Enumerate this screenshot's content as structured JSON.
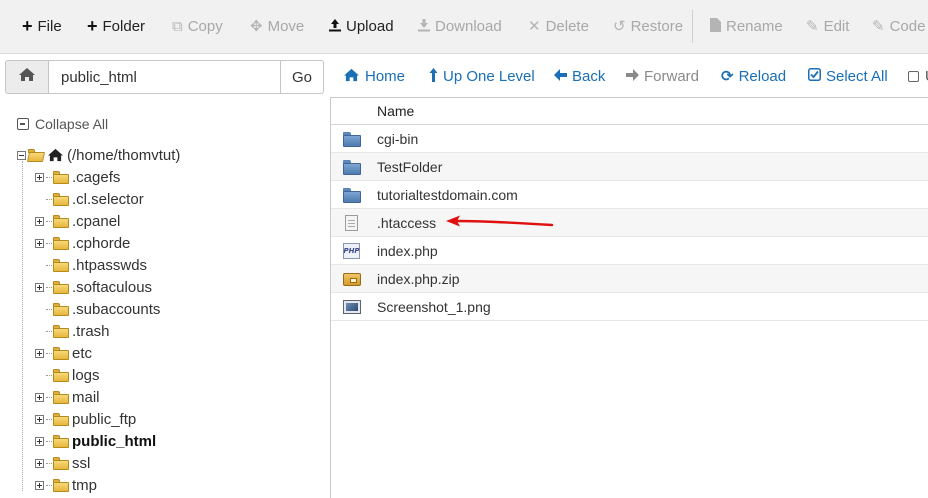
{
  "toolbar": {
    "file": "File",
    "folder": "Folder",
    "copy": "Copy",
    "move": "Move",
    "upload": "Upload",
    "download": "Download",
    "delete": "Delete",
    "restore": "Restore",
    "rename": "Rename",
    "edit": "Edit",
    "code": "Code"
  },
  "pathbar": {
    "path_value": "public_html",
    "go_label": "Go"
  },
  "nav": {
    "home": "Home",
    "up_one_level": "Up One Level",
    "back": "Back",
    "forward": "Forward",
    "reload": "Reload",
    "select_all": "Select All",
    "unselect_all_partial": "U"
  },
  "tree": {
    "collapse_all": "Collapse All",
    "root": "(/home/thomvtut)",
    "items": [
      {
        "label": ".cagefs",
        "expandable": true
      },
      {
        "label": ".cl.selector",
        "expandable": false
      },
      {
        "label": ".cpanel",
        "expandable": true
      },
      {
        "label": ".cphorde",
        "expandable": true
      },
      {
        "label": ".htpasswds",
        "expandable": false
      },
      {
        "label": ".softaculous",
        "expandable": true
      },
      {
        "label": ".subaccounts",
        "expandable": false
      },
      {
        "label": ".trash",
        "expandable": false
      },
      {
        "label": "etc",
        "expandable": true
      },
      {
        "label": "logs",
        "expandable": false
      },
      {
        "label": "mail",
        "expandable": true
      },
      {
        "label": "public_ftp",
        "expandable": true
      },
      {
        "label": "public_html",
        "expandable": true,
        "current": true
      },
      {
        "label": "ssl",
        "expandable": true
      },
      {
        "label": "tmp",
        "expandable": true
      }
    ]
  },
  "files": {
    "column_name": "Name",
    "rows": [
      {
        "name": "cgi-bin",
        "icon": "folder-icon"
      },
      {
        "name": "TestFolder",
        "icon": "folder-icon"
      },
      {
        "name": "tutorialtestdomain.com",
        "icon": "folder-icon"
      },
      {
        "name": ".htaccess",
        "icon": "text-file-icon"
      },
      {
        "name": "index.php",
        "icon": "php-file-icon"
      },
      {
        "name": "index.php.zip",
        "icon": "zip-file-icon"
      },
      {
        "name": "Screenshot_1.png",
        "icon": "image-file-icon"
      }
    ]
  },
  "colors": {
    "link_blue": "#1a6fb5",
    "annotation_arrow": "#e01010",
    "toolbar_bg": "#f1f1f1"
  },
  "php_icon_text": "PHP"
}
